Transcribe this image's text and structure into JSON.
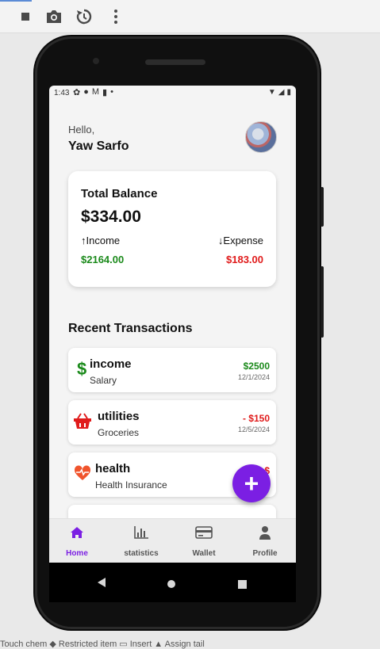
{
  "status_bar": {
    "time": "1:43"
  },
  "header": {
    "greeting": "Hello,",
    "username": "Yaw Sarfo"
  },
  "balance_card": {
    "title": "Total Balance",
    "amount": "$334.00",
    "income_label": "↑Income",
    "expense_label": "↓Expense",
    "income_value": "$2164.00",
    "expense_value": "$183.00"
  },
  "recent": {
    "title": "Recent Transactions"
  },
  "transactions": [
    {
      "category": "income",
      "subtitle": "Salary",
      "amount": "$2500",
      "date": "12/1/2024",
      "icon": "dollar-icon"
    },
    {
      "category": "utilities",
      "subtitle": "Groceries",
      "amount": "- $150",
      "date": "12/5/2024",
      "icon": "basket-icon"
    },
    {
      "category": "health",
      "subtitle": "Health Insurance",
      "amount": "- $",
      "date": "",
      "icon": "heart-pulse-icon"
    }
  ],
  "fab": {
    "label": "+"
  },
  "bottom_nav": [
    {
      "label": "Home",
      "icon": "home-icon",
      "active": true
    },
    {
      "label": "statistics",
      "icon": "bar-chart-icon",
      "active": false
    },
    {
      "label": "Wallet",
      "icon": "wallet-icon",
      "active": false
    },
    {
      "label": "Profile",
      "icon": "person-icon",
      "active": false
    }
  ],
  "colors": {
    "accent": "#7b1fe3",
    "income": "#1b8a1b",
    "expense": "#e01b1b",
    "nav_inactive": "#555555"
  },
  "footer_strip": "Touch  chem  ◆ Restricted  item  ▭  Insert  ▲ Assign  tail"
}
